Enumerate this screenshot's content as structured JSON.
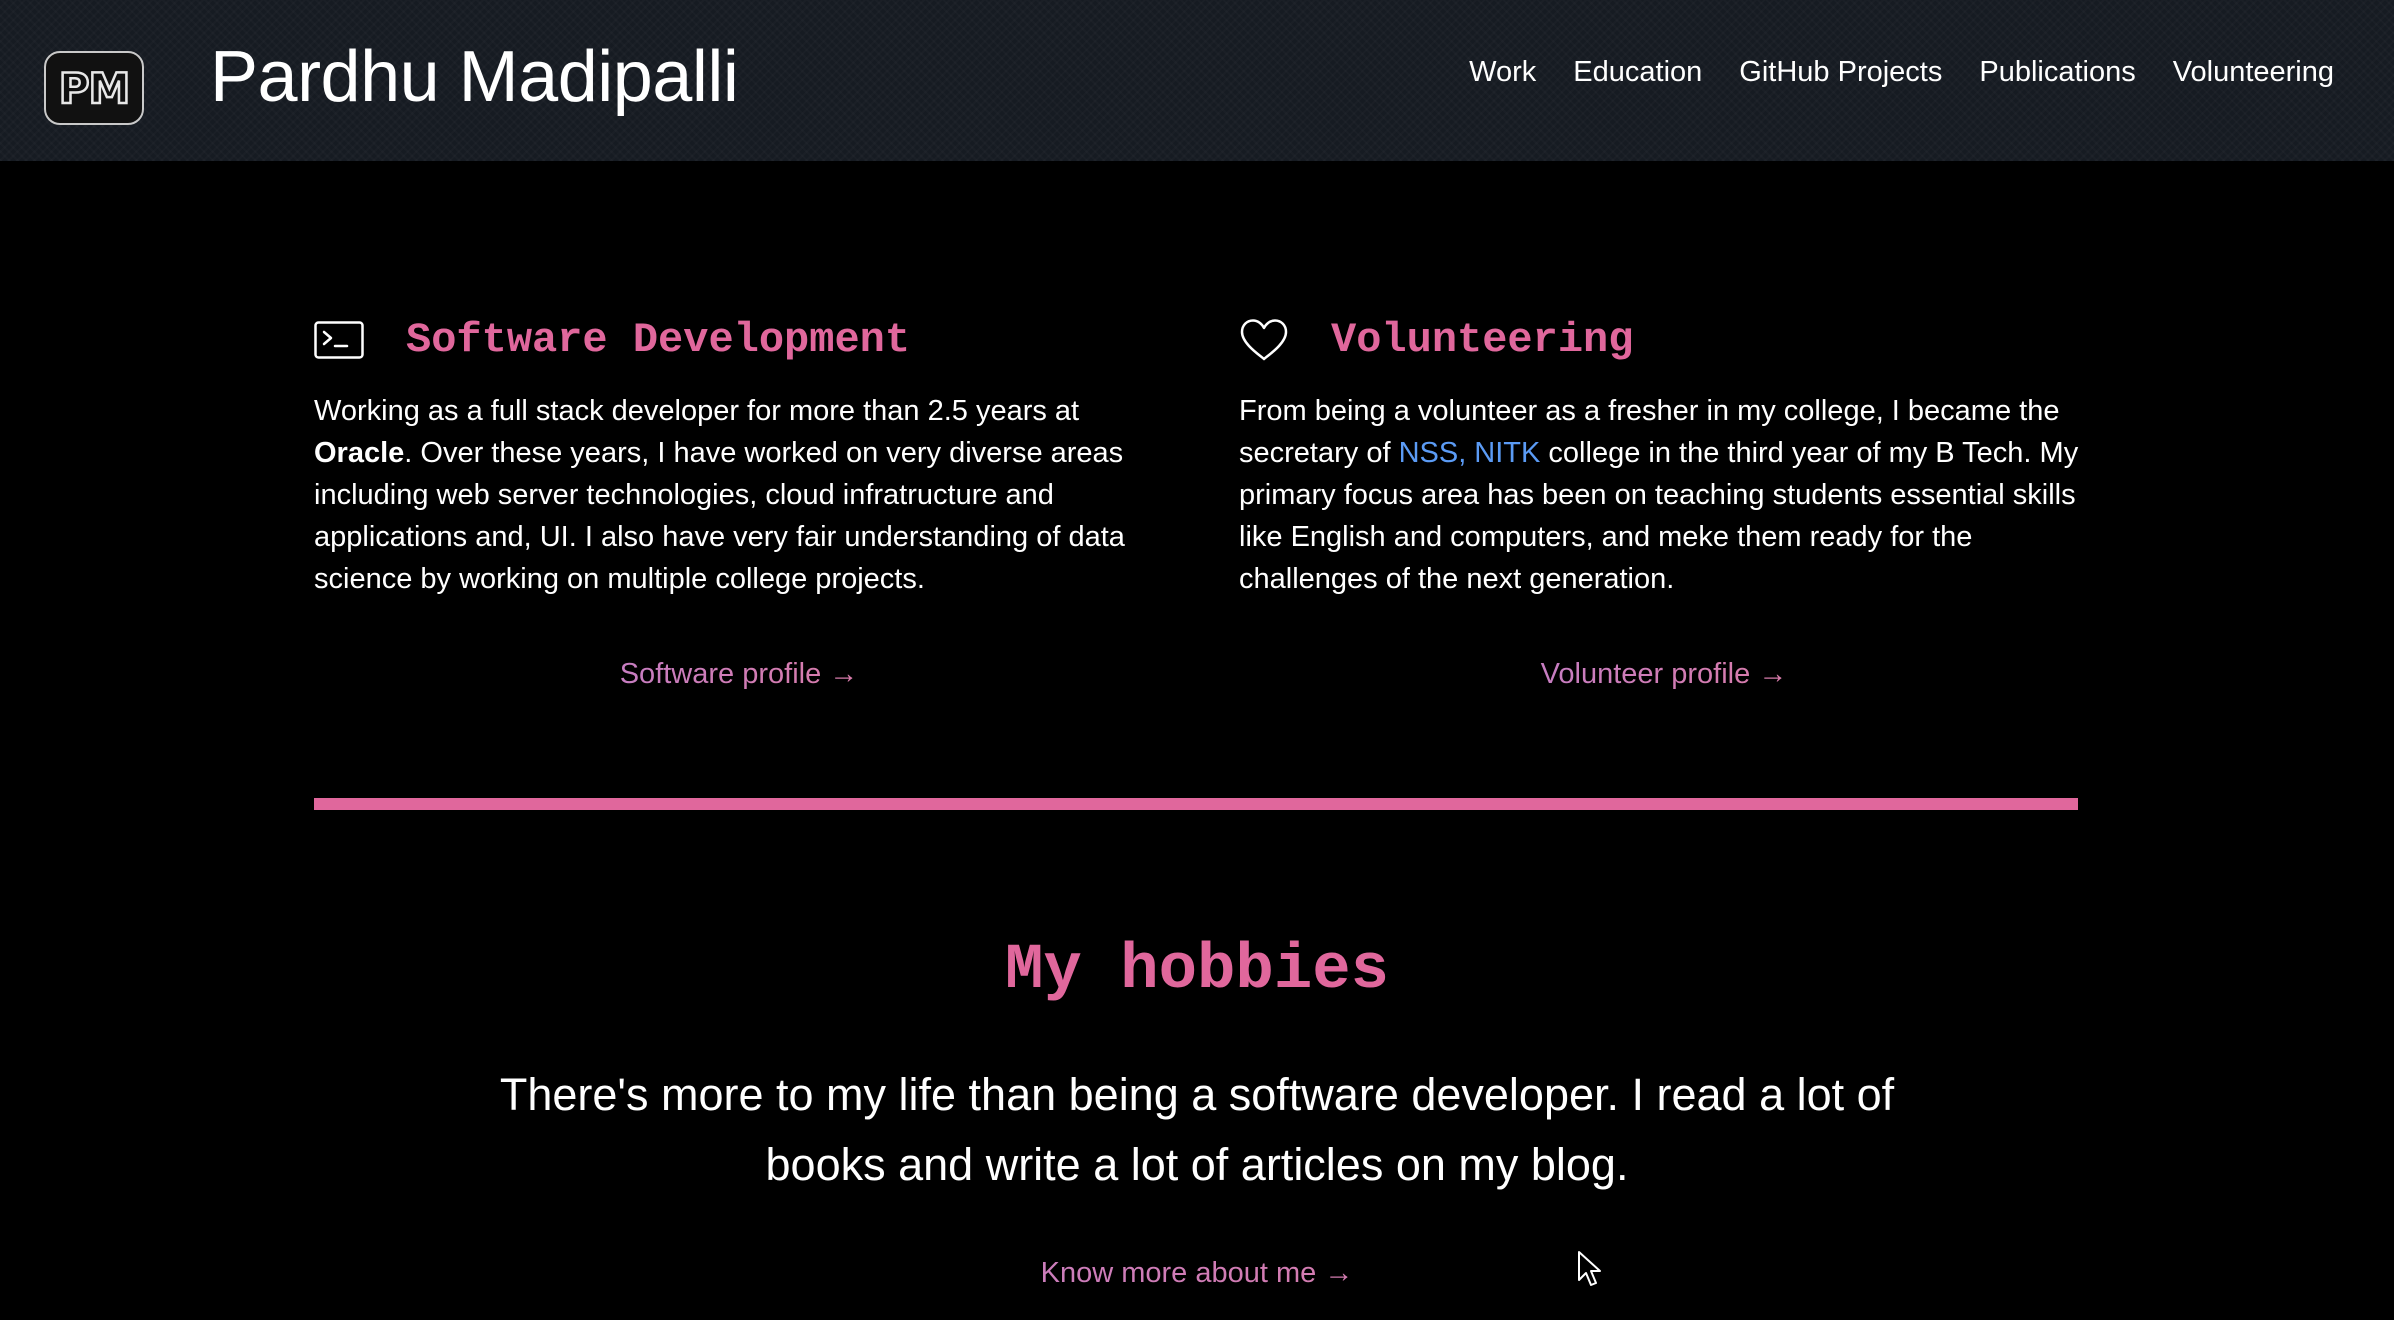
{
  "header": {
    "logo_text": "PM",
    "site_name": "Pardhu Madipalli",
    "nav": [
      "Work",
      "Education",
      "GitHub Projects",
      "Publications",
      "Volunteering"
    ]
  },
  "software": {
    "icon": "terminal-icon",
    "title": "Software Development",
    "body_1": "Working as a full stack developer for more than 2.5 years at ",
    "body_bold": "Oracle",
    "body_2": ". Over these years, I have worked on very diverse areas including web server technologies, cloud infratructure and applications and, UI. I also have very fair understanding of data science by working on multiple college projects.",
    "link": "Software profile →"
  },
  "volunteering": {
    "icon": "heart-icon",
    "title": "Volunteering",
    "body_1": "From being a volunteer as a fresher in my college, I became the secretary of ",
    "body_link": "NSS, NITK",
    "body_2": " college in the third year of my B Tech. My primary focus area has been on teaching students essential skills like English and computers, and meke them ready for the challenges of the next generation.",
    "link": "Volunteer profile →"
  },
  "hobbies": {
    "title": "My hobbies",
    "text": "There's more to my life than being a software developer. I read a lot of books and write a lot of articles on my blog.",
    "link": "Know more about me →"
  },
  "colors": {
    "accent_pink": "#e0679c",
    "link_blue": "#5b9bf5",
    "gradient_start": "#b07fe0",
    "gradient_end": "#f07a8c",
    "navbar_bg": "#161b22"
  }
}
